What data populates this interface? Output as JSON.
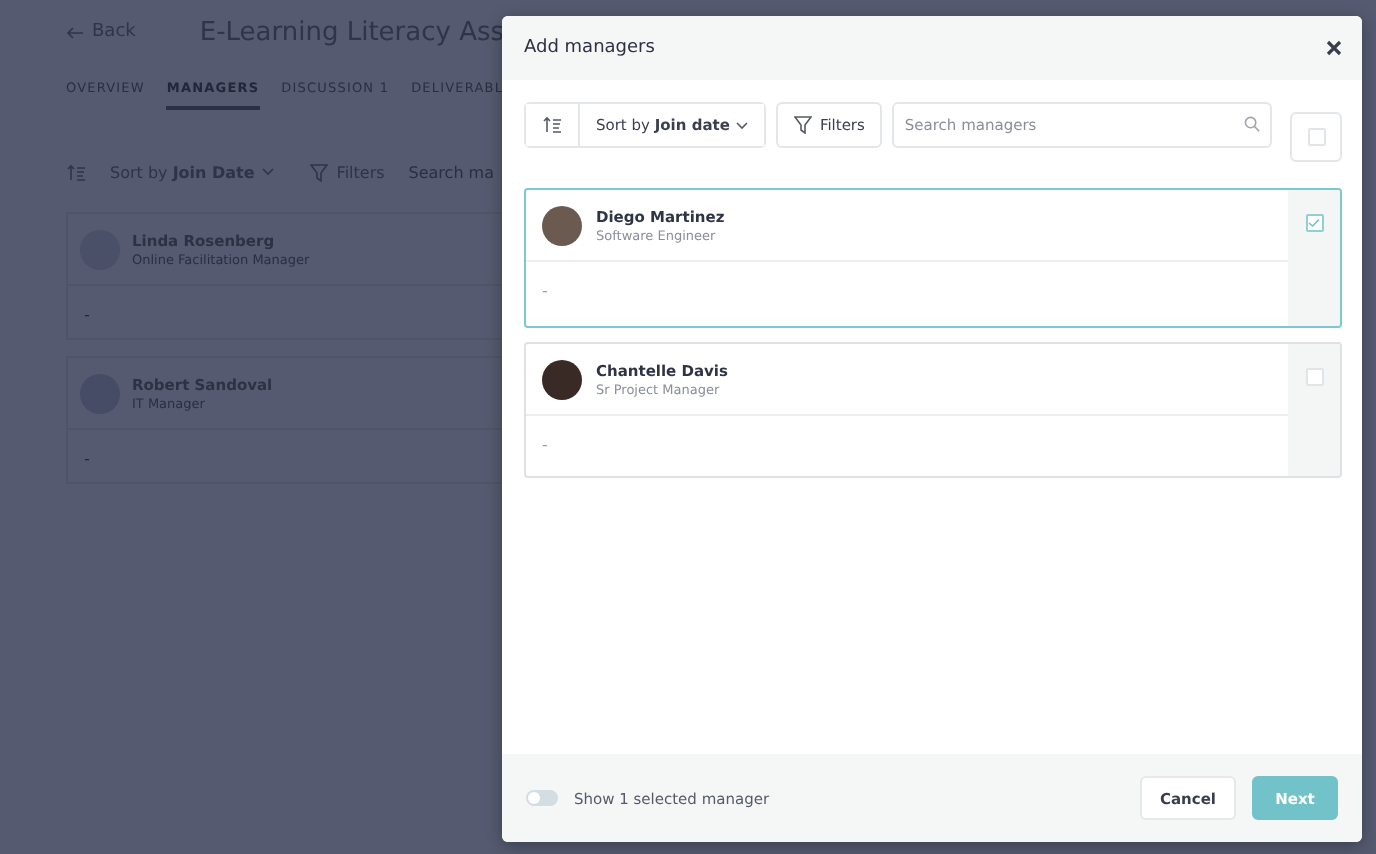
{
  "page": {
    "back": "Back",
    "title": "E-Learning Literacy Ass",
    "tabs": [
      {
        "label": "OVERVIEW",
        "selected": false
      },
      {
        "label": "MANAGERS",
        "selected": true
      },
      {
        "label": "DISCUSSION",
        "count": "1",
        "selected": false
      },
      {
        "label": "DELIVERABL",
        "selected": false
      }
    ],
    "sort": {
      "prefix": "Sort by",
      "value": "Join Date"
    },
    "filters": "Filters",
    "search": {
      "placeholder": "Search ma"
    },
    "managers": [
      {
        "name": "Linda Rosenberg",
        "role": "Online Facilitation Manager",
        "note": "-"
      },
      {
        "name": "Robert Sandoval",
        "role": "IT Manager",
        "note": "-"
      }
    ]
  },
  "dialog": {
    "title": "Add managers",
    "sort": {
      "prefix": "Sort by",
      "value": "Join date"
    },
    "filters": "Filters",
    "search": {
      "placeholder": "Search managers"
    },
    "select_all": {
      "checked": false
    },
    "managers": [
      {
        "name": "Diego Martinez",
        "role": "Software Engineer",
        "note": "-",
        "checked": true
      },
      {
        "name": "Chantelle Davis",
        "role": "Sr Project Manager",
        "note": "-",
        "checked": false
      }
    ],
    "footer": {
      "toggle": {
        "label": "Show 1 selected manager",
        "on": false
      },
      "buttons": [
        {
          "label": "Cancel",
          "kind": "secondary"
        },
        {
          "label": "Next",
          "kind": "primary"
        }
      ]
    }
  }
}
